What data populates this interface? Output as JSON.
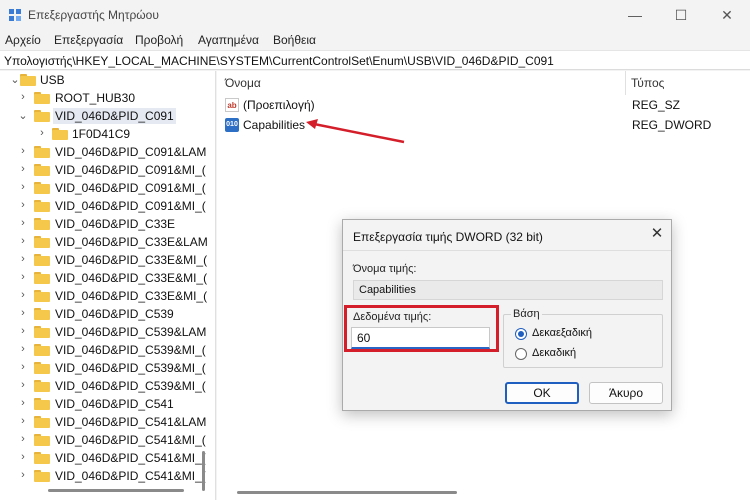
{
  "window": {
    "title": "Επεξεργαστής Μητρώου",
    "minimize": "—",
    "maximize": "☐",
    "close": "✕"
  },
  "menu": [
    "Αρχείο",
    "Επεξεργασία",
    "Προβολή",
    "Αγαπημένα",
    "Βοήθεια"
  ],
  "address": "Υπολογιστής\\HKEY_LOCAL_MACHINE\\SYSTEM\\CurrentControlSet\\Enum\\USB\\VID_046D&PID_C091",
  "tree": {
    "usb_label": "USB",
    "root_hub_label": "ROOT_HUB30",
    "selected_label": "VID_046D&PID_C091",
    "child_label": "1F0D41C9",
    "items": [
      "VID_046D&PID_C091&LAM",
      "VID_046D&PID_C091&MI_(",
      "VID_046D&PID_C091&MI_(",
      "VID_046D&PID_C091&MI_(",
      "VID_046D&PID_C33E",
      "VID_046D&PID_C33E&LAM",
      "VID_046D&PID_C33E&MI_(",
      "VID_046D&PID_C33E&MI_(",
      "VID_046D&PID_C33E&MI_(",
      "VID_046D&PID_C539",
      "VID_046D&PID_C539&LAM",
      "VID_046D&PID_C539&MI_(",
      "VID_046D&PID_C539&MI_(",
      "VID_046D&PID_C539&MI_(",
      "VID_046D&PID_C541",
      "VID_046D&PID_C541&LAM",
      "VID_046D&PID_C541&MI_(",
      "VID_046D&PID_C541&MI_(",
      "VID_046D&PID_C541&MI_("
    ]
  },
  "list": {
    "col_name": "Όνομα",
    "col_type": "Τύπος",
    "rows": [
      {
        "icon": "ab",
        "name": "(Προεπιλογή)",
        "type": "REG_SZ"
      },
      {
        "icon": "010",
        "name": "Capabilities",
        "type": "REG_DWORD"
      }
    ]
  },
  "dialog": {
    "title": "Επεξεργασία τιμής DWORD (32 bit)",
    "close": "✕",
    "value_name_label": "Όνομα τιμής:",
    "value_name": "Capabilities",
    "value_data_label": "Δεδομένα τιμής:",
    "value_data": "60",
    "base_label": "Βάση",
    "hex_label": "Δεκαεξαδική",
    "dec_label": "Δεκαδική",
    "base_selected": "Δεκαεξαδική",
    "ok": "OK",
    "cancel": "Άκυρο"
  },
  "colors": {
    "highlight_red": "#d41f2a",
    "accent_blue": "#1f5fbf",
    "folder_yellow": "#f5c84c"
  }
}
